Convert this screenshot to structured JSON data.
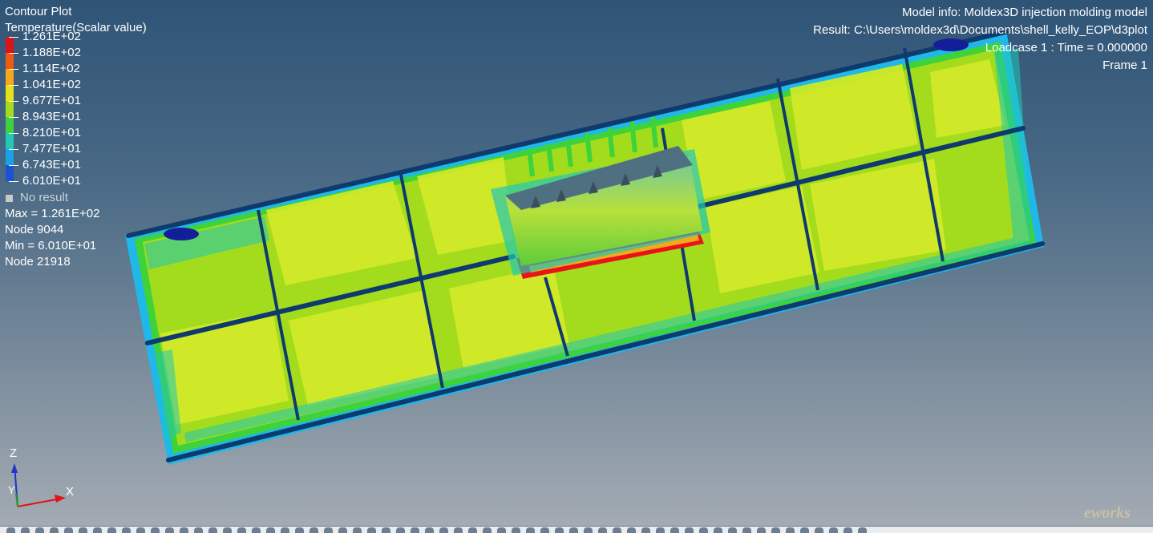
{
  "legend": {
    "plot_title": "Contour Plot",
    "quantity": "Temperature(Scalar value)",
    "levels": [
      {
        "label": "1.261E+02",
        "color": "#d9141a"
      },
      {
        "label": "1.188E+02",
        "color": "#ee5a12"
      },
      {
        "label": "1.114E+02",
        "color": "#f4a81a"
      },
      {
        "label": "1.041E+02",
        "color": "#e6e21a"
      },
      {
        "label": "9.677E+01",
        "color": "#a3dc1c"
      },
      {
        "label": "8.943E+01",
        "color": "#3ed33a"
      },
      {
        "label": "8.210E+01",
        "color": "#21c8b4"
      },
      {
        "label": "7.477E+01",
        "color": "#1aa2e6"
      },
      {
        "label": "6.743E+01",
        "color": "#1a52d2"
      },
      {
        "label": "6.010E+01",
        "color": "#131f98"
      }
    ],
    "no_result": "No result",
    "max_label": "Max = 1.261E+02",
    "max_node": "Node 9044",
    "min_label": "Min = 6.010E+01",
    "min_node": "Node 21918"
  },
  "info": {
    "model_info": "Model info: Moldex3D injection molding model",
    "result": "Result: C:\\Users\\moldex3d\\Documents\\shell_kelly_EOP\\d3plot",
    "loadcase": "Loadcase 1 : Time = 0.000000",
    "frame": "Frame 1"
  },
  "triad": {
    "z": "Z",
    "y": "Y",
    "x": "X"
  },
  "watermark": {
    "text": "eworks"
  },
  "colors": {
    "outer": "#1fb8e8",
    "body": "#9fdc1e",
    "body_light": "#d6ec2c",
    "rib": "#0e3a6e",
    "boss": "#4f7080",
    "hot": "#e8141a"
  }
}
